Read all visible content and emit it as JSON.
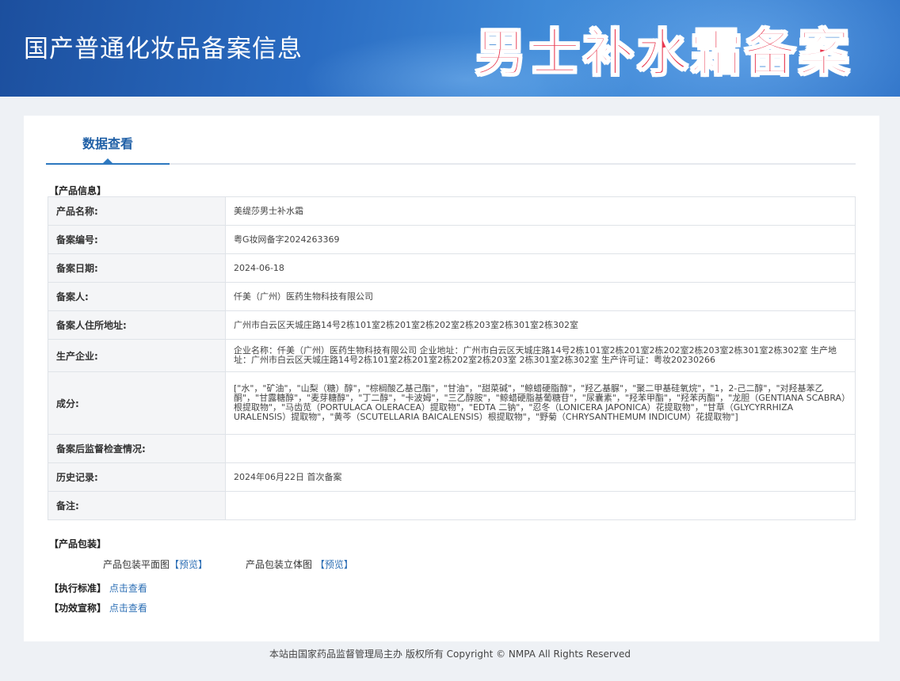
{
  "banner": {
    "title": "国产普通化妆品备案信息",
    "overlay_title": "男士补水霜备案"
  },
  "tab": {
    "label": "数据查看"
  },
  "product_info": {
    "section_label": "【产品信息】",
    "rows": [
      {
        "key": "产品名称:",
        "value": "美缇莎男士补水霜"
      },
      {
        "key": "备案编号:",
        "value": "粤G妆网备字2024263369"
      },
      {
        "key": "备案日期:",
        "value": "2024-06-18"
      },
      {
        "key": "备案人:",
        "value": "仟美（广州）医药生物科技有限公司"
      },
      {
        "key": "备案人住所地址:",
        "value": "广州市白云区天城庄路14号2栋101室2栋201室2栋202室2栋203室2栋301室2栋302室"
      },
      {
        "key": "生产企业:",
        "value": "企业名称：仟美（广州）医药生物科技有限公司 企业地址：广州市白云区天城庄路14号2栋101室2栋201室2栋202室2栋203室2栋301室2栋302室 生产地址：广州市白云区天城庄路14号2栋101室2栋201室2栋202室2栋203室 2栋301室2栋302室 生产许可证：粤妆20230266"
      },
      {
        "key": "成分:",
        "value": "[\"水\"，\"矿油\"，\"山梨（糖）醇\"，\"棕榈酸乙基己酯\"，\"甘油\"，\"甜菜碱\"，\"鲸蜡硬脂醇\"，\"羟乙基脲\"，\"聚二甲基硅氧烷\"，\"1，2-己二醇\"，\"对羟基苯乙酮\"，\"甘露糖醇\"，\"麦芽糖醇\"，\"丁二醇\"，\"卡波姆\"，\"三乙醇胺\"，\"鲸蜡硬脂基葡糖苷\"，\"尿囊素\"，\"羟苯甲酯\"，\"羟苯丙酯\"，\"龙胆（GENTIANA SCABRA）根提取物\"，\"马齿苋（PORTULACA OLERACEA）提取物\"，\"EDTA 二钠\"，\"忍冬（LONICERA JAPONICA）花提取物\"，\"甘草（GLYCYRRHIZA URALENSIS）提取物\"，\"黄芩（SCUTELLARIA BAICALENSIS）根提取物\"，\"野菊（CHRYSANTHEMUM INDICUM）花提取物\"]"
      },
      {
        "key": "备案后监督检查情况:",
        "value": ""
      },
      {
        "key": "历史记录:",
        "value": "2024年06月22日 首次备案"
      },
      {
        "key": "备注:",
        "value": ""
      }
    ]
  },
  "packaging": {
    "section_label": "【产品包装】",
    "flat_label": "产品包装平面图",
    "flat_link": "【预览】",
    "solid_label": "产品包装立体图",
    "solid_link": "【预览】"
  },
  "standard": {
    "label": "【执行标准】",
    "link": "点击查看"
  },
  "efficacy": {
    "label": "【功效宣称】",
    "link": "点击查看"
  },
  "footer": {
    "text": "本站由国家药品监督管理局主办 版权所有 Copyright © NMPA All Rights Reserved"
  }
}
